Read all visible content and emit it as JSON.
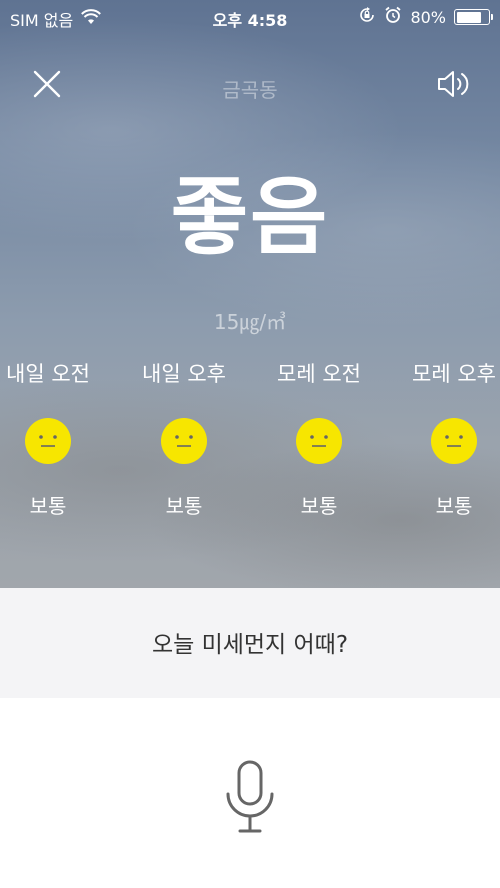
{
  "status_bar": {
    "carrier": "SIM 없음",
    "wifi_icon": "wifi-icon",
    "time": "오후 4:58",
    "orientation_lock_icon": "orientation-lock-icon",
    "alarm_icon": "alarm-icon",
    "battery_percent": "80%",
    "battery_level": 0.8
  },
  "header": {
    "close_icon": "close-icon",
    "location": "금곡동",
    "speaker_icon": "speaker-icon"
  },
  "current": {
    "grade": "좋음",
    "concentration": "15㎍/㎥"
  },
  "forecast": {
    "items": [
      {
        "label": "내일 오전",
        "status": "보통",
        "icon": "neutral-face-icon"
      },
      {
        "label": "내일 오후",
        "status": "보통",
        "icon": "neutral-face-icon"
      },
      {
        "label": "모레 오전",
        "status": "보통",
        "icon": "neutral-face-icon"
      },
      {
        "label": "모레 오후",
        "status": "보통",
        "icon": "neutral-face-icon"
      }
    ]
  },
  "question": {
    "text": "오늘 미세먼지 어때?"
  },
  "voice": {
    "mic_icon": "microphone-icon"
  },
  "colors": {
    "face_yellow": "#f7e600",
    "question_bg": "#f4f4f6",
    "mic_gray": "#666666"
  }
}
